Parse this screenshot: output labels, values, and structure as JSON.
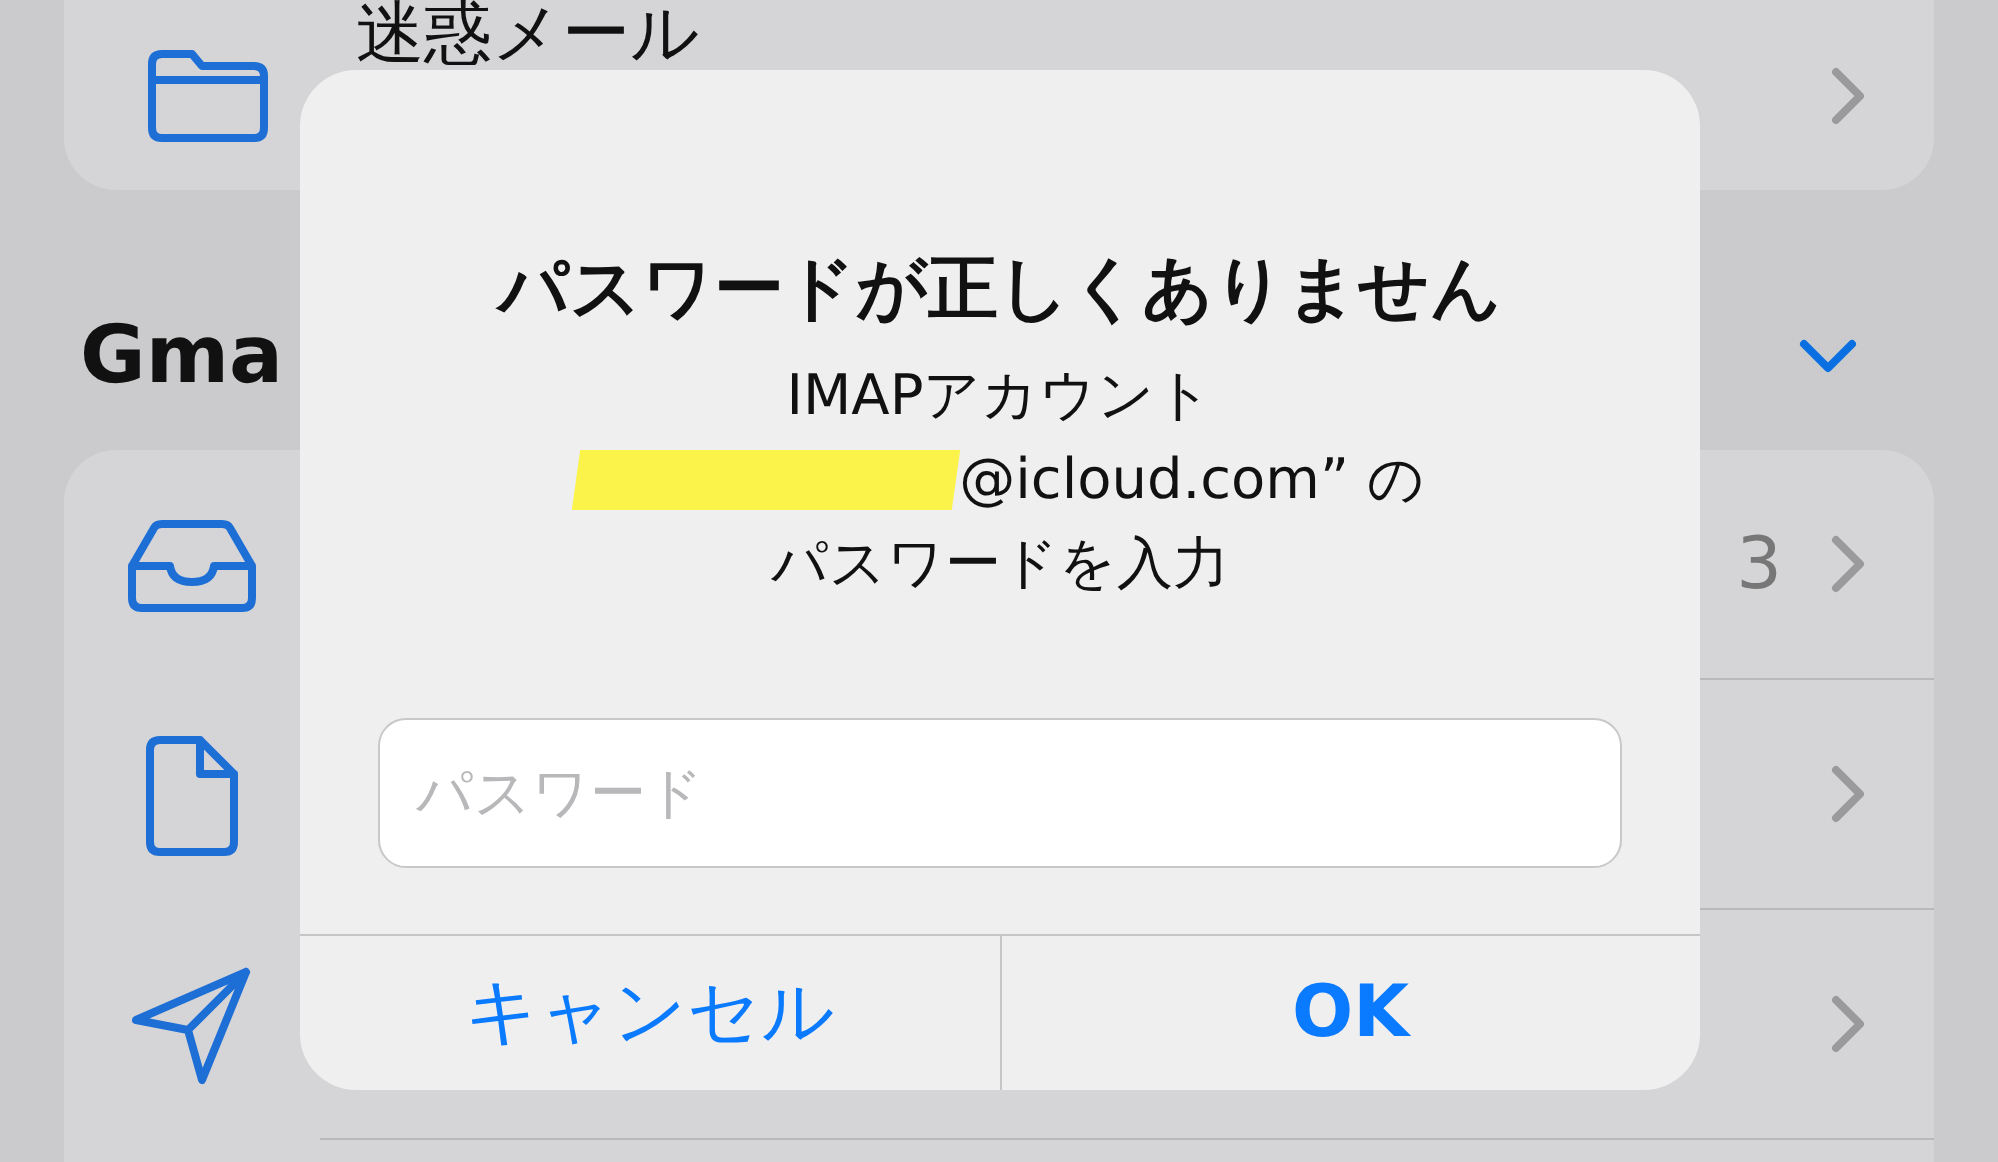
{
  "background": {
    "top_card": {
      "rows": [
        {
          "kind": "folder",
          "label": "迷惑メール"
        }
      ]
    },
    "section": {
      "title": "Gma",
      "expanded": true
    },
    "mailboxes": [
      {
        "kind": "inbox",
        "count": "3"
      },
      {
        "kind": "document"
      },
      {
        "kind": "sent"
      }
    ]
  },
  "dialog": {
    "title": "パスワードが正しくありません",
    "message": [
      "IMAPアカウント",
      "@icloud.com” の",
      "パスワードを入力"
    ],
    "redacted": true,
    "field": {
      "placeholder": "パスワード"
    },
    "buttons": [
      {
        "kind": "cancel",
        "label": "キャンセル"
      },
      {
        "kind": "default",
        "label": "OK"
      }
    ]
  }
}
